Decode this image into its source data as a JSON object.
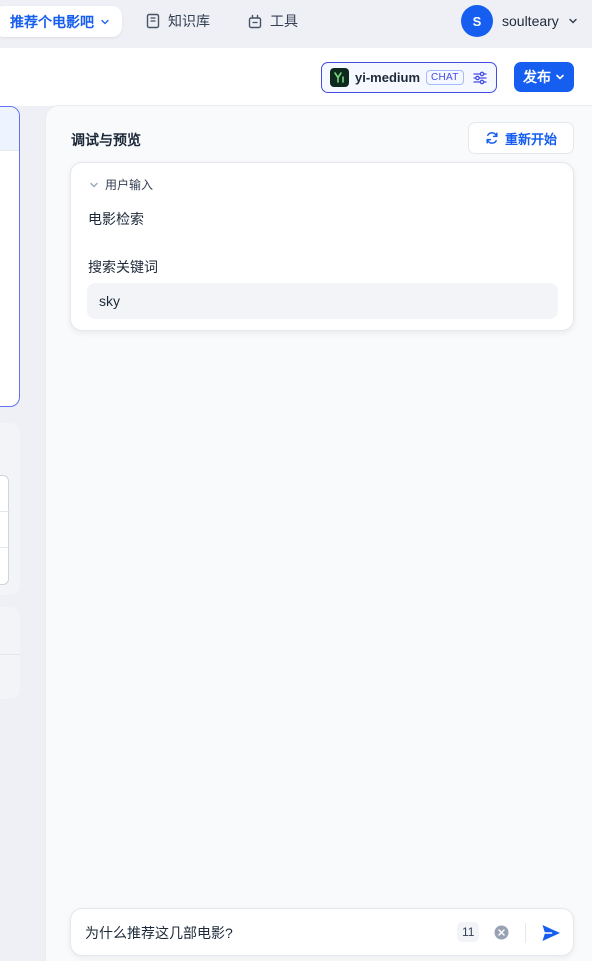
{
  "nav": {
    "app_name": "推荐个电影吧",
    "knowledge": "知识库",
    "tools": "工具",
    "user_initial": "S",
    "username": "soulteary"
  },
  "header": {
    "model_name": "yi-medium",
    "model_mode": "CHAT",
    "publish": "发布"
  },
  "debug": {
    "title": "调试与预览",
    "restart": "重新开始",
    "section_label": "用户输入",
    "field_name": "电影检索",
    "input_label": "搜索关键词",
    "input_value": "sky"
  },
  "chat": {
    "query": "为什么推荐这几部电影?",
    "char_count": "11"
  },
  "colors": {
    "accent": "#155eef",
    "model_border": "#444ce7"
  }
}
